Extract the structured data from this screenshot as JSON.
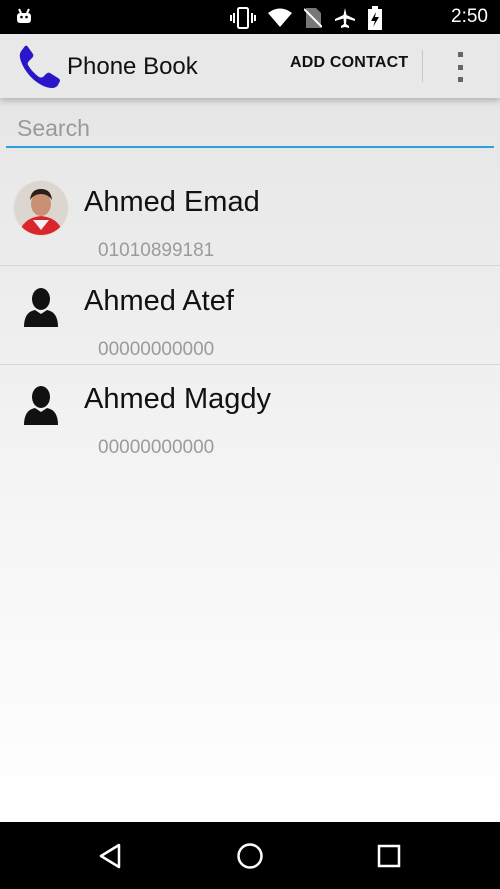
{
  "status_bar": {
    "time": "2:50",
    "icons": [
      "android-icon",
      "vibrate-icon",
      "wifi-icon",
      "no-sim-icon",
      "airplane-icon",
      "battery-charging-icon"
    ]
  },
  "action_bar": {
    "title": "Phone Book",
    "app_icon": "phone-handset-icon",
    "add_contact_label": "ADD CONTACT",
    "overflow_icon": "overflow-menu-icon"
  },
  "search": {
    "placeholder": "Search",
    "value": ""
  },
  "contacts": [
    {
      "name": "Ahmed Emad",
      "phone": "01010899181",
      "avatar": "photo"
    },
    {
      "name": "Ahmed Atef",
      "phone": "00000000000",
      "avatar": "default-person-icon"
    },
    {
      "name": "Ahmed Magdy",
      "phone": "00000000000",
      "avatar": "default-person-icon"
    }
  ],
  "nav_bar": [
    "back-icon",
    "home-icon",
    "recents-icon"
  ],
  "colors": {
    "accent": "#2f9fd8",
    "app_icon": "#2a16c8",
    "actionbar_bg": "#e8e8e8"
  }
}
